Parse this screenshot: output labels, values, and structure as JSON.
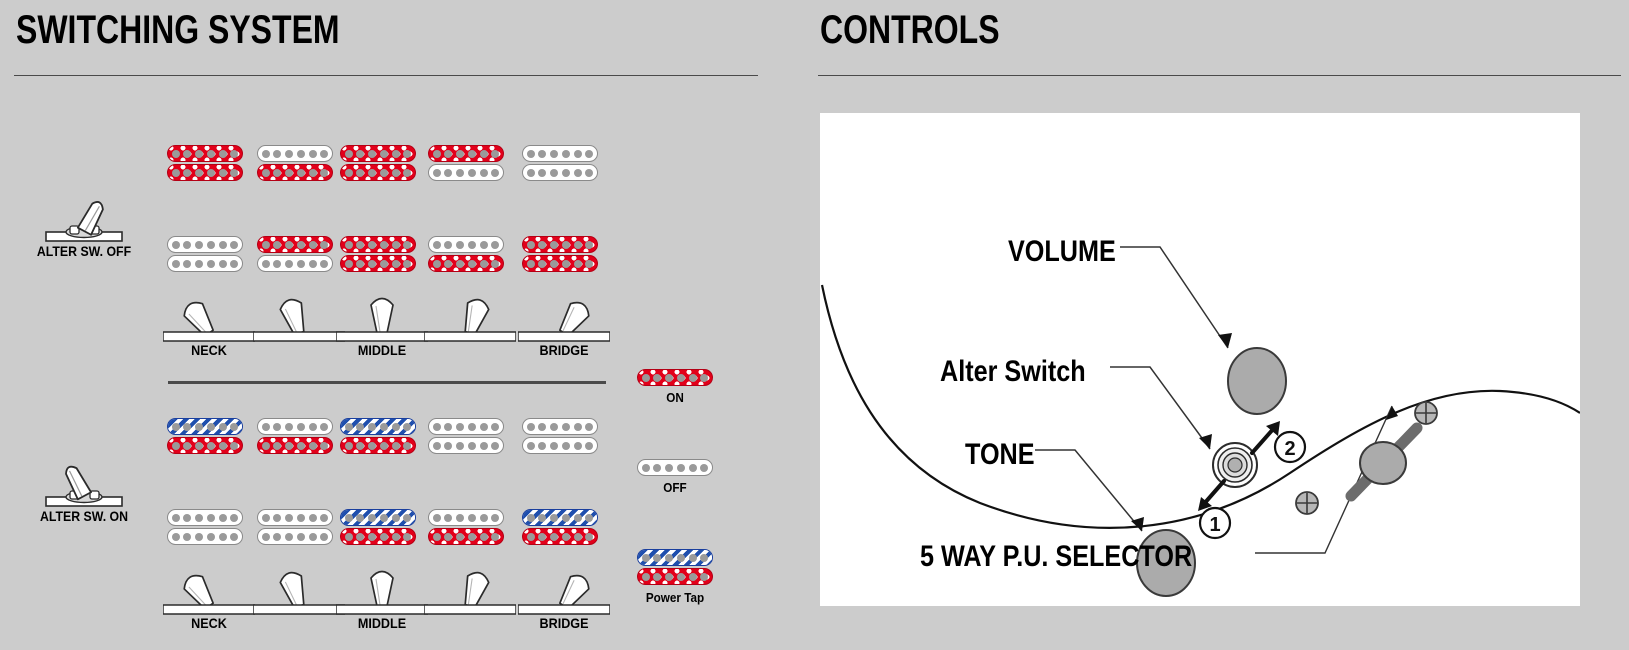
{
  "panels": {
    "switching": {
      "title": "SWITCHING SYSTEM"
    },
    "controls": {
      "title": "CONTROLS"
    }
  },
  "colors": {
    "background": "#cccccc",
    "panel_white": "#ffffff",
    "coil_on": "#e2001a",
    "coil_off": "#ffffff",
    "coil_tap": "#1f4fae",
    "pole": "#9a9a9a",
    "knob": "#a8a8a8",
    "rule": "#4a4a4a",
    "text": "#000000"
  },
  "switching": {
    "sections": [
      {
        "id": "alter-off",
        "switch_label": "ALTER SW. OFF",
        "switch_state": "off",
        "switch_icon": "toggle-switch-icon",
        "positions": [
          {
            "index": 1,
            "label": "NECK",
            "lever_angle": -34,
            "pickups": [
              {
                "row": "neck",
                "coils": [
                  "on",
                  "on"
                ]
              },
              {
                "row": "bridge",
                "coils": [
                  "off",
                  "off"
                ]
              }
            ]
          },
          {
            "index": 2,
            "label": "",
            "lever_angle": -17,
            "pickups": [
              {
                "row": "neck",
                "coils": [
                  "off",
                  "on"
                ]
              },
              {
                "row": "bridge",
                "coils": [
                  "on",
                  "off"
                ]
              }
            ]
          },
          {
            "index": 3,
            "label": "MIDDLE",
            "lever_angle": 0,
            "pickups": [
              {
                "row": "neck",
                "coils": [
                  "on",
                  "on"
                ]
              },
              {
                "row": "bridge",
                "coils": [
                  "on",
                  "on"
                ]
              }
            ]
          },
          {
            "index": 4,
            "label": "",
            "lever_angle": 17,
            "pickups": [
              {
                "row": "neck",
                "coils": [
                  "on",
                  "off"
                ]
              },
              {
                "row": "bridge",
                "coils": [
                  "off",
                  "on"
                ]
              }
            ]
          },
          {
            "index": 5,
            "label": "BRIDGE",
            "lever_angle": 34,
            "pickups": [
              {
                "row": "neck",
                "coils": [
                  "off",
                  "off"
                ]
              },
              {
                "row": "bridge",
                "coils": [
                  "on",
                  "on"
                ]
              }
            ]
          }
        ]
      },
      {
        "id": "alter-on",
        "switch_label": "ALTER SW. ON",
        "switch_state": "on",
        "switch_icon": "toggle-switch-icon",
        "positions": [
          {
            "index": 1,
            "label": "NECK",
            "lever_angle": -34,
            "pickups": [
              {
                "row": "neck",
                "coils": [
                  "tap",
                  "on"
                ]
              },
              {
                "row": "bridge",
                "coils": [
                  "off",
                  "off"
                ]
              }
            ]
          },
          {
            "index": 2,
            "label": "",
            "lever_angle": -17,
            "pickups": [
              {
                "row": "neck",
                "coils": [
                  "off",
                  "on"
                ]
              },
              {
                "row": "bridge",
                "coils": [
                  "off",
                  "off"
                ]
              }
            ]
          },
          {
            "index": 3,
            "label": "MIDDLE",
            "lever_angle": 0,
            "pickups": [
              {
                "row": "neck",
                "coils": [
                  "tap",
                  "on"
                ]
              },
              {
                "row": "bridge",
                "coils": [
                  "tap",
                  "on"
                ]
              }
            ]
          },
          {
            "index": 4,
            "label": "",
            "lever_angle": 17,
            "pickups": [
              {
                "row": "neck",
                "coils": [
                  "off",
                  "off"
                ]
              },
              {
                "row": "bridge",
                "coils": [
                  "off",
                  "on"
                ]
              }
            ]
          },
          {
            "index": 5,
            "label": "BRIDGE",
            "lever_angle": 34,
            "pickups": [
              {
                "row": "neck",
                "coils": [
                  "off",
                  "off"
                ]
              },
              {
                "row": "bridge",
                "coils": [
                  "tap",
                  "on"
                ]
              }
            ]
          }
        ]
      }
    ],
    "legend": [
      {
        "id": "on",
        "label": "ON",
        "coils": [
          "on"
        ]
      },
      {
        "id": "off",
        "label": "OFF",
        "coils": [
          "off"
        ]
      },
      {
        "id": "power-tap",
        "label": "Power Tap",
        "coils": [
          "tap",
          "on"
        ]
      }
    ]
  },
  "controls": {
    "callouts": [
      {
        "id": "volume",
        "label": "VOLUME",
        "style": "upper"
      },
      {
        "id": "alter",
        "label": "Alter Switch",
        "style": "mixed"
      },
      {
        "id": "tone",
        "label": "TONE",
        "style": "upper"
      },
      {
        "id": "selector",
        "label": "5 WAY P.U. SELECTOR",
        "style": "upper"
      }
    ],
    "markers": [
      {
        "id": "marker-1",
        "label": "1"
      },
      {
        "id": "marker-2",
        "label": "2"
      }
    ],
    "parts": {
      "volume_knob": "volume-knob-icon",
      "tone_knob": "tone-knob-icon",
      "alter_switch": "alter-switch-icon",
      "selector_lever": "five-way-selector-icon",
      "screws": [
        "screw-icon",
        "screw-icon"
      ],
      "body_outline": "guitar-body-outline"
    }
  }
}
